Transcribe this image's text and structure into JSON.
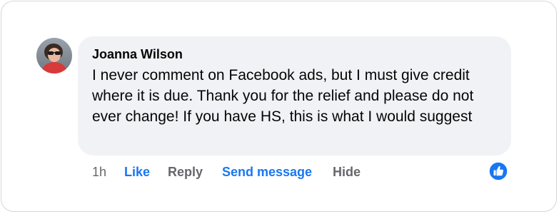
{
  "comment": {
    "author": "Joanna Wilson",
    "text": "I never comment on Facebook ads, but I must give credit where it is due. Thank you for the relief and please do not ever change! If you have HS, this is what I would suggest",
    "avatar_icon": "user-avatar-photo"
  },
  "actions": {
    "time": "1h",
    "like": "Like",
    "reply": "Reply",
    "send_message": "Send message",
    "hide": "Hide"
  },
  "reaction": {
    "icon": "thumbs-up-icon",
    "color": "#1877f2"
  },
  "colors": {
    "bubble": "#f0f2f5",
    "link_blue": "#1877f2",
    "muted": "#65676b"
  }
}
